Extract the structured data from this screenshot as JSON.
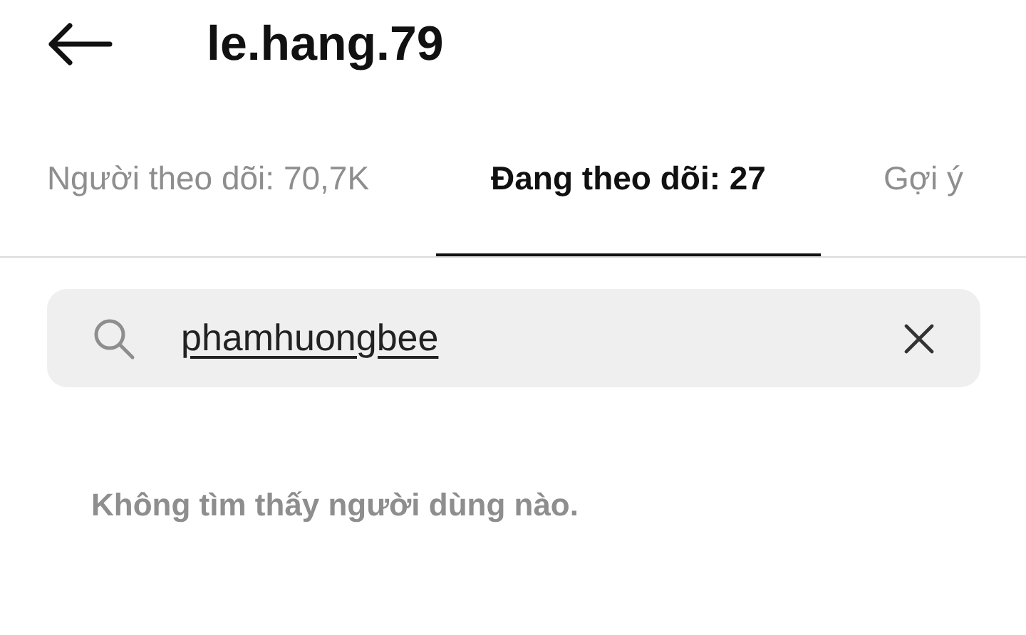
{
  "header": {
    "title": "le.hang.79"
  },
  "tabs": [
    {
      "label": "Người theo dõi: 70,7K",
      "selected": false
    },
    {
      "label": "Đang theo dõi: 27",
      "selected": true
    },
    {
      "label": "Gợi ý",
      "selected": false
    }
  ],
  "search": {
    "value": "phamhuongbee"
  },
  "message": "Không tìm thấy người dùng nào."
}
